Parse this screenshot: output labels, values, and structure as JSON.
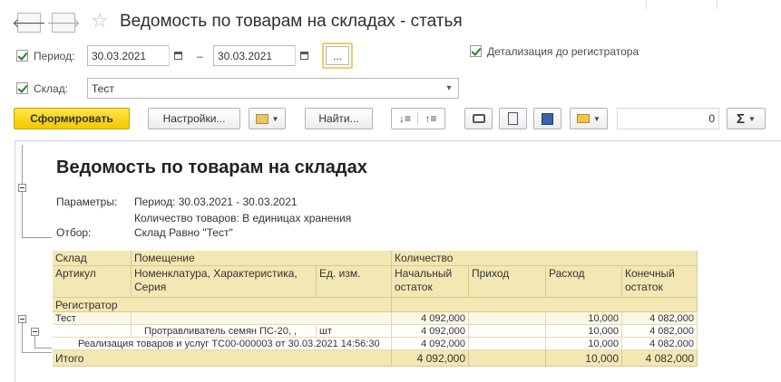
{
  "window": {
    "title": "Ведомость по товарам на складах - статья",
    "back_icon": "🡐",
    "forward_icon": "🡒",
    "star_icon": "☆"
  },
  "params": {
    "period_label": "Период:",
    "date_from": "30.03.2021",
    "date_to": "30.03.2021",
    "date_sep": "–",
    "ellipsis": "...",
    "detail_label": "Детализация до регистратора",
    "warehouse_label": "Склад:",
    "warehouse_value": "Тест"
  },
  "toolbar": {
    "generate": "Сформировать",
    "settings": "Настройки...",
    "find": "Найти...",
    "sum_value": "0",
    "sum_symbol": "Σ"
  },
  "report": {
    "title": "Ведомость по товарам на складах",
    "params_label": "Параметры:",
    "param_line1": "Период: 30.03.2021 - 30.03.2021",
    "param_line2": "Количество товаров: В единицах хранения",
    "filter_label": "Отбор:",
    "filter_value": "Склад Равно \"Тест\""
  },
  "table": {
    "headers": {
      "warehouse": "Склад",
      "room": "Помещение",
      "quantity": "Количество",
      "article": "Артикул",
      "nomenclature": "Номенклатура, Характеристика,",
      "series": "Серия",
      "unit": "Ед. изм.",
      "opening": "Начальный",
      "opening2": "остаток",
      "income": "Приход",
      "expense": "Расход",
      "closing": "Конечный",
      "closing2": "остаток",
      "registrar": "Регистратор"
    },
    "rows": [
      {
        "name": "Тест",
        "unit": "",
        "opening": "4 092,000",
        "income": "",
        "expense": "10,000",
        "closing": "4 082,000"
      },
      {
        "name": "Протравливатель семян ПС-20, ,",
        "unit": "шт",
        "opening": "4 092,000",
        "income": "",
        "expense": "10,000",
        "closing": "4 082,000"
      },
      {
        "name": "Реализация товаров и услуг ТС00-000003 от 30.03.2021 14:56:30",
        "unit": "",
        "opening": "4 092,000",
        "income": "",
        "expense": "10,000",
        "closing": "4 082,000"
      }
    ],
    "total": {
      "label": "Итого",
      "opening": "4 092,000",
      "income": "",
      "expense": "10,000",
      "closing": "4 082,000"
    }
  }
}
